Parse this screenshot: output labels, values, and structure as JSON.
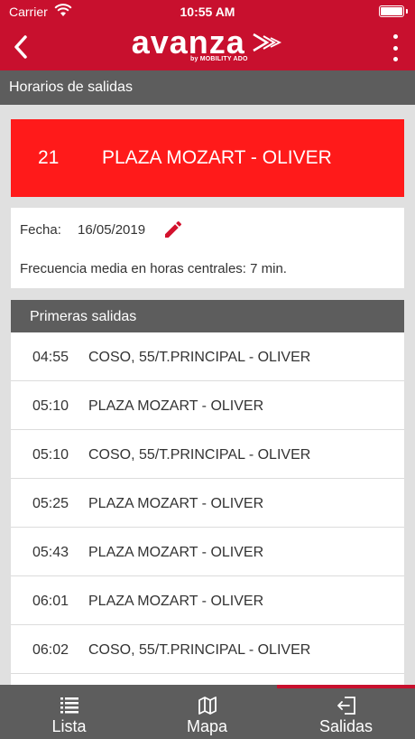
{
  "status_bar": {
    "carrier": "Carrier",
    "time": "10:55 AM"
  },
  "navbar": {
    "logo_text": "avanza",
    "logo_subtitle": "by MOBILITY ADO"
  },
  "section_title": "Horarios de salidas",
  "route": {
    "number": "21",
    "name": "PLAZA MOZART - OLIVER"
  },
  "info": {
    "fecha_label": "Fecha:",
    "fecha_value": "16/05/2019",
    "frequency": "Frecuencia media en horas centrales: 7 min."
  },
  "departures": {
    "header": "Primeras salidas",
    "rows": [
      {
        "time": "04:55",
        "destination": "COSO, 55/T.PRINCIPAL - OLIVER"
      },
      {
        "time": "05:10",
        "destination": "PLAZA MOZART - OLIVER"
      },
      {
        "time": "05:10",
        "destination": "COSO, 55/T.PRINCIPAL - OLIVER"
      },
      {
        "time": "05:25",
        "destination": "PLAZA MOZART - OLIVER"
      },
      {
        "time": "05:43",
        "destination": "PLAZA MOZART - OLIVER"
      },
      {
        "time": "06:01",
        "destination": "PLAZA MOZART - OLIVER"
      },
      {
        "time": "06:02",
        "destination": "COSO, 55/T.PRINCIPAL - OLIVER"
      }
    ]
  },
  "tabs": [
    {
      "label": "Lista",
      "icon": "list-icon"
    },
    {
      "label": "Mapa",
      "icon": "map-icon"
    },
    {
      "label": "Salidas",
      "icon": "exit-icon",
      "active": true
    }
  ],
  "colors": {
    "brand_red": "#c8102e",
    "banner_red": "#ff1a1a",
    "header_gray": "#5d5d5d"
  }
}
